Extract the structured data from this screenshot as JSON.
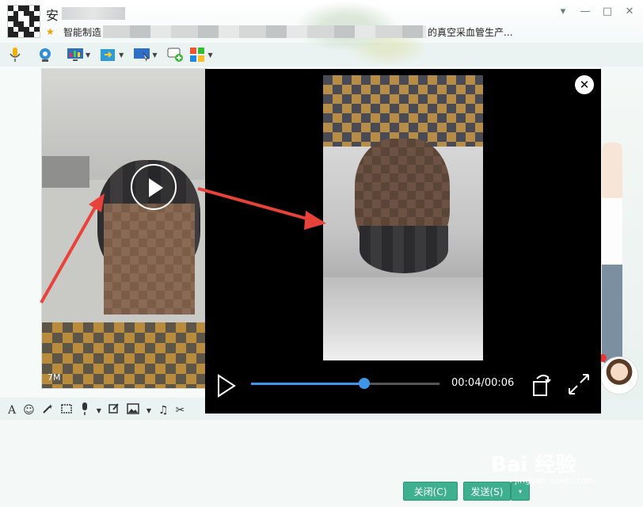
{
  "header": {
    "title_char": "安",
    "subtitle_prefix": "智能制造",
    "subtitle_suffix": "的真空采血管生产..."
  },
  "window_controls": {
    "menu": "▾",
    "minimize": "—",
    "maximize": "□",
    "close": "✕"
  },
  "toolbar": {
    "icons": [
      "microphone-icon",
      "video-call-icon",
      "remote-desktop-icon",
      "file-transfer-icon",
      "screen-share-icon",
      "add-chat-icon",
      "apps-icon"
    ]
  },
  "chat": {
    "video_size_label": "7M"
  },
  "player": {
    "close_symbol": "✕",
    "time_text": "00:04/00:06",
    "progress": 0.6
  },
  "input_toolbar": {
    "font_symbol": "A",
    "emoji_symbol": "☺",
    "music_symbol": "♫",
    "cut_symbol": "✂"
  },
  "buttons": {
    "close_label": "关闭(C)",
    "send_label": "发送(S)",
    "send_arrow": "▾"
  },
  "watermark": {
    "text": "Bai 经验",
    "sub": "jingyan.baidu.com"
  },
  "colors": {
    "accent_green": "#3fb08f",
    "progress_blue": "#3f95e8",
    "arrow_red": "#e8423b"
  }
}
